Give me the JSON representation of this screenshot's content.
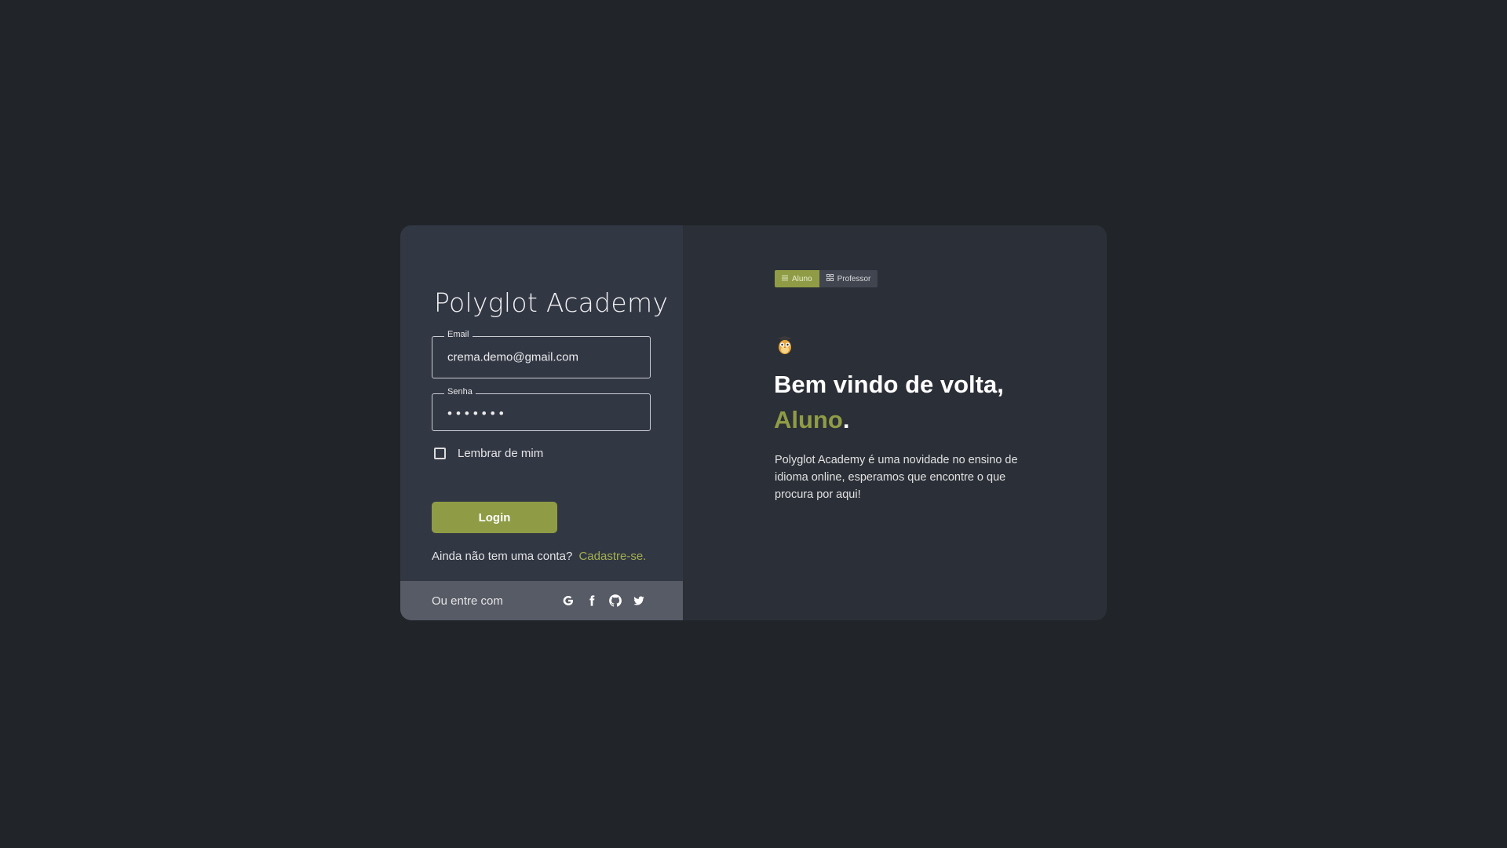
{
  "login": {
    "app_title": "Polyglot Academy",
    "email_label": "Email",
    "email_value": "crema.demo@gmail.com",
    "password_label": "Senha",
    "password_value": "•••••••",
    "remember_label": "Lembrar de mim",
    "login_button": "Login",
    "no_account_text": "Ainda não tem uma conta?",
    "signup_link": "Cadastre-se.",
    "social_text": "Ou entre com",
    "social_icons": [
      "google-icon",
      "facebook-icon",
      "github-icon",
      "twitter-icon"
    ]
  },
  "welcome": {
    "toggle": {
      "student": "Aluno",
      "teacher": "Professor",
      "selected": "Aluno"
    },
    "heading_line1": "Bem vindo de volta,",
    "heading_name": "Aluno",
    "heading_punct": ".",
    "description": "Polyglot Academy é uma novidade no ensino  de idioma online, esperamos que encontre o que procura por aqui!"
  },
  "colors": {
    "background": "#212529",
    "accent": "#8f9c45",
    "left_panel": "#323744",
    "right_panel": "#2b2f37"
  }
}
